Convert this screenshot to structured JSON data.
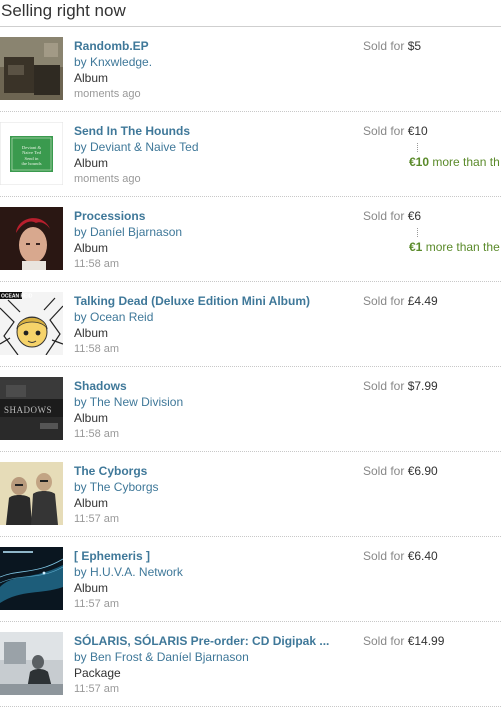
{
  "heading": "Selling right now",
  "items": [
    {
      "title": "Randomb.EP",
      "artist": "by Knxwledge.",
      "type": "Album",
      "time": "moments ago",
      "sold_label": "Sold for",
      "price": "$5",
      "extra_amount": "",
      "extra_text": ""
    },
    {
      "title": "Send In The Hounds",
      "artist": "by Deviant & Naive Ted",
      "type": "Album",
      "time": "moments ago",
      "sold_label": "Sold for",
      "price": "€10",
      "extra_amount": "€10",
      "extra_text": " more than th"
    },
    {
      "title": "Processions",
      "artist": "by Daníel Bjarnason",
      "type": "Album",
      "time": "11:58 am",
      "sold_label": "Sold for",
      "price": "€6",
      "extra_amount": "€1",
      "extra_text": " more than the"
    },
    {
      "title": "Talking Dead (Deluxe Edition Mini Album)",
      "artist": "by Ocean Reid",
      "type": "Album",
      "time": "11:58 am",
      "sold_label": "Sold for",
      "price": "£4.49",
      "extra_amount": "",
      "extra_text": ""
    },
    {
      "title": "Shadows",
      "artist": "by The New Division",
      "type": "Album",
      "time": "11:58 am",
      "sold_label": "Sold for",
      "price": "$7.99",
      "extra_amount": "",
      "extra_text": ""
    },
    {
      "title": "The Cyborgs",
      "artist": "by The Cyborgs",
      "type": "Album",
      "time": "11:57 am",
      "sold_label": "Sold for",
      "price": "€6.90",
      "extra_amount": "",
      "extra_text": ""
    },
    {
      "title": "[ Ephemeris ]",
      "artist": "by H.U.V.A. Network",
      "type": "Album",
      "time": "11:57 am",
      "sold_label": "Sold for",
      "price": "€6.40",
      "extra_amount": "",
      "extra_text": ""
    },
    {
      "title": "SÓLARIS, SÓLARIS Pre-order: CD Digipak ...",
      "artist": "by Ben Frost & Daníel Bjarnason",
      "type": "Package",
      "time": "11:57 am",
      "sold_label": "Sold for",
      "price": "€14.99",
      "extra_amount": "",
      "extra_text": ""
    }
  ],
  "art": [
    {
      "name": "randomb-ep-cover-art",
      "lettering": ""
    },
    {
      "name": "send-in-the-hounds-cover-art",
      "lettering": "Deviant & Naive Ted Send in the hounds"
    },
    {
      "name": "processions-cover-art",
      "lettering": ""
    },
    {
      "name": "talking-dead-cover-art",
      "lettering": "OCEAN REID"
    },
    {
      "name": "shadows-cover-art",
      "lettering": "SHADOWS"
    },
    {
      "name": "the-cyborgs-cover-art",
      "lettering": ""
    },
    {
      "name": "ephemeris-cover-art",
      "lettering": ""
    },
    {
      "name": "solaris-cover-art",
      "lettering": ""
    }
  ],
  "colors": {
    "link": "#3f7899",
    "increase": "#5a8a2a",
    "muted": "#999999"
  }
}
